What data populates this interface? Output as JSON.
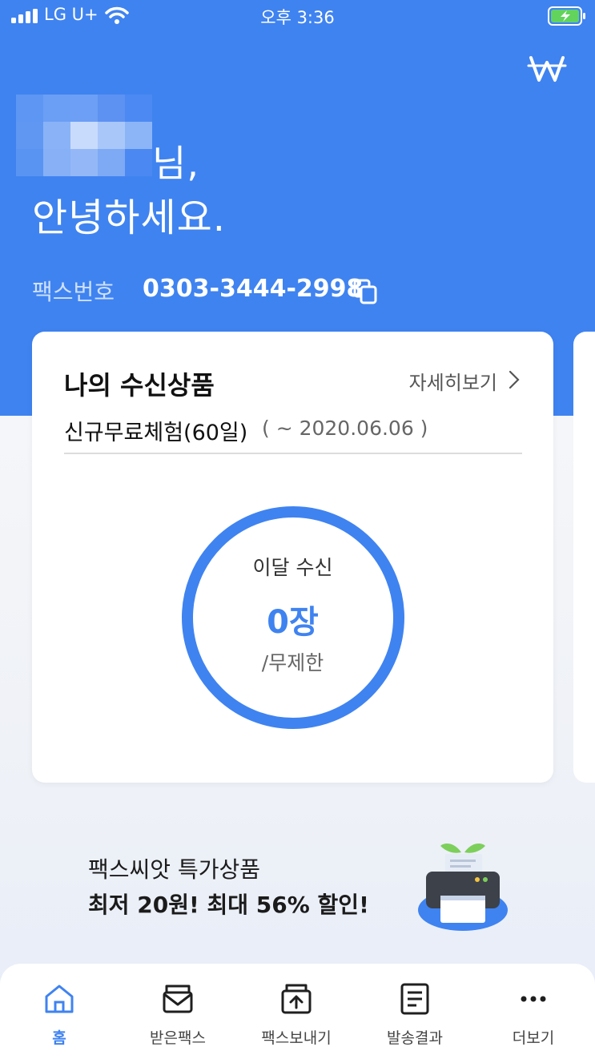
{
  "status_bar": {
    "carrier": "LG U+",
    "time": "오후 3:36",
    "icons": [
      "signal-icon",
      "wifi-icon",
      "battery-charging-icon"
    ]
  },
  "header": {
    "logo_icon": "w-logo-icon",
    "greeting_line1": "님,",
    "greeting_line2": "안녕하세요.",
    "fax_label": "팩스번호",
    "fax_number": "0303-3444-2998",
    "copy_icon": "copy-icon"
  },
  "card": {
    "title": "나의 수신상품",
    "detail_link": "자세히보기",
    "plan_name": "신규무료체험(60일)",
    "plan_period": "( ~ 2020.06.06 )",
    "ring_label": "이달 수신",
    "ring_count": "0장",
    "ring_limit": "/무제한"
  },
  "promo": {
    "line1": "팩스씨앗 특가상품",
    "line2": "최저 20원! 최대 56% 할인!",
    "icon": "printer-sprout-icon"
  },
  "tabbar": {
    "items": [
      {
        "label": "홈",
        "icon": "home-icon",
        "active": true
      },
      {
        "label": "받은팩스",
        "icon": "inbox-envelope-icon",
        "active": false
      },
      {
        "label": "팩스보내기",
        "icon": "send-fax-icon",
        "active": false
      },
      {
        "label": "발송결과",
        "icon": "document-list-icon",
        "active": false
      },
      {
        "label": "더보기",
        "icon": "more-dots-icon",
        "active": false
      }
    ]
  },
  "colors": {
    "brand_blue": "#3f83f0",
    "text_dark": "#1b1b1b"
  }
}
